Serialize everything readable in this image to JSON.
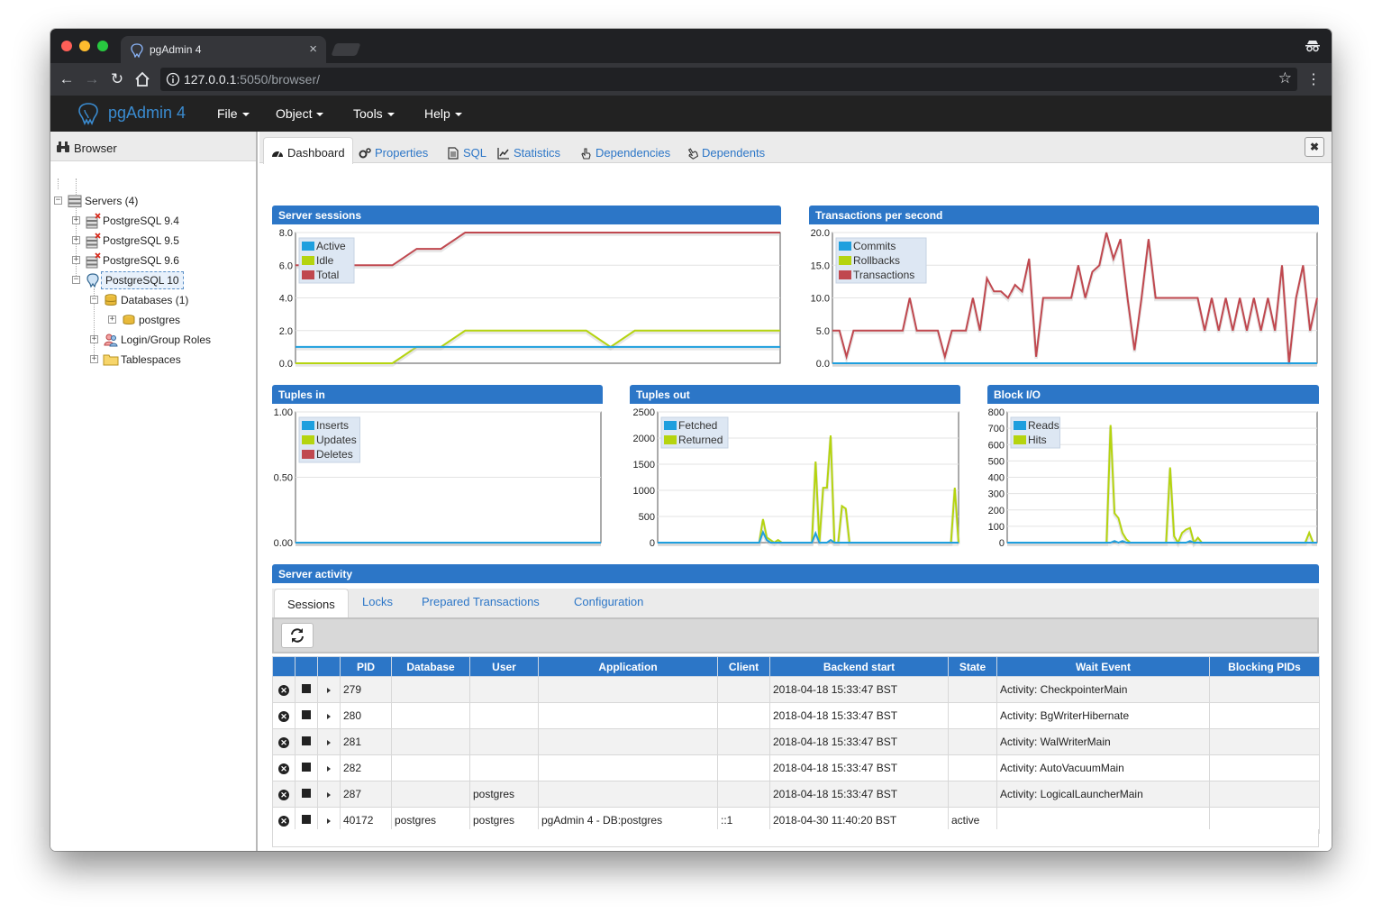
{
  "chrome": {
    "tab_title": "pgAdmin 4",
    "tab_close": "×",
    "url_host": "127.0.0.1",
    "url_rest": ":5050/browser/"
  },
  "app": {
    "brand": "pgAdmin 4",
    "menus": [
      "File",
      "Object",
      "Tools",
      "Help"
    ]
  },
  "browser_panel": {
    "title": "Browser",
    "tree": {
      "servers": "Servers (4)",
      "pg94": "PostgreSQL 9.4",
      "pg95": "PostgreSQL 9.5",
      "pg96": "PostgreSQL 9.6",
      "pg10": "PostgreSQL 10",
      "databases": "Databases (1)",
      "postgres": "postgres",
      "roles": "Login/Group Roles",
      "tablespaces": "Tablespaces"
    }
  },
  "main_tabs": [
    "Dashboard",
    "Properties",
    "SQL",
    "Statistics",
    "Dependencies",
    "Dependents"
  ],
  "close_label": "✖",
  "charts": {
    "server_sessions": {
      "title": "Server sessions",
      "legend": [
        "Active",
        "Idle",
        "Total"
      ],
      "yticks": [
        "0.0",
        "2.0",
        "4.0",
        "6.0",
        "8.0"
      ]
    },
    "tps": {
      "title": "Transactions per second",
      "legend": [
        "Commits",
        "Rollbacks",
        "Transactions"
      ],
      "yticks": [
        "0.0",
        "5.0",
        "10.0",
        "15.0",
        "20.0"
      ]
    },
    "tuples_in": {
      "title": "Tuples in",
      "legend": [
        "Inserts",
        "Updates",
        "Deletes"
      ],
      "yticks": [
        "0.00",
        "0.50",
        "1.00"
      ]
    },
    "tuples_out": {
      "title": "Tuples out",
      "legend": [
        "Fetched",
        "Returned"
      ],
      "yticks": [
        "0",
        "500",
        "1000",
        "1500",
        "2000",
        "2500"
      ]
    },
    "block_io": {
      "title": "Block I/O",
      "legend": [
        "Reads",
        "Hits"
      ],
      "yticks": [
        "0",
        "100",
        "200",
        "300",
        "400",
        "500",
        "600",
        "700",
        "800"
      ]
    }
  },
  "chart_data": [
    {
      "type": "line",
      "title": "Server sessions",
      "ylim": [
        0,
        8
      ],
      "x": [
        0,
        1,
        2,
        3,
        4,
        5,
        6,
        7,
        8,
        9,
        10,
        11,
        12,
        13,
        14,
        15,
        16,
        17,
        18,
        19,
        20
      ],
      "series": [
        {
          "name": "Active",
          "values": [
            1,
            1,
            1,
            1,
            1,
            1,
            1,
            1,
            1,
            1,
            1,
            1,
            1,
            1,
            1,
            1,
            1,
            1,
            1,
            1,
            1
          ]
        },
        {
          "name": "Idle",
          "values": [
            0,
            0,
            0,
            0,
            0,
            1,
            1,
            2,
            2,
            2,
            2,
            2,
            2,
            1,
            2,
            2,
            2,
            2,
            2,
            2,
            2
          ]
        },
        {
          "name": "Total",
          "values": [
            6,
            6,
            6,
            6,
            6,
            7,
            7,
            8,
            8,
            8,
            8,
            8,
            8,
            8,
            8,
            8,
            8,
            8,
            8,
            8,
            8
          ]
        }
      ],
      "colors": [
        "#1e9fde",
        "#b5d40f",
        "#c0484f"
      ]
    },
    {
      "type": "line",
      "title": "Transactions per second",
      "ylim": [
        0,
        20
      ],
      "series": [
        {
          "name": "Commits",
          "values": [
            0,
            0,
            0,
            0,
            0,
            0,
            0,
            0,
            0,
            0,
            0,
            0,
            0,
            0,
            0,
            0,
            0,
            0,
            0,
            0,
            0,
            0,
            0,
            0,
            0,
            0,
            0,
            0,
            0,
            0,
            0,
            0,
            0,
            0,
            0,
            0,
            0,
            0,
            0,
            0,
            0,
            0,
            0,
            0,
            0,
            0,
            0,
            0,
            0,
            0,
            0,
            0,
            0,
            0,
            0,
            0,
            0,
            0,
            0,
            0,
            0,
            0,
            0,
            0,
            0,
            0,
            0,
            0,
            0,
            0
          ]
        },
        {
          "name": "Rollbacks",
          "values": [
            0,
            0,
            0,
            0,
            0,
            0,
            0,
            0,
            0,
            0,
            0,
            0,
            0,
            0,
            0,
            0,
            0,
            0,
            0,
            0,
            0,
            0,
            0,
            0,
            0,
            0,
            0,
            0,
            0,
            0,
            0,
            0,
            0,
            0,
            0,
            0,
            0,
            0,
            0,
            0,
            0,
            0,
            0,
            0,
            0,
            0,
            0,
            0,
            0,
            0,
            0,
            0,
            0,
            0,
            0,
            0,
            0,
            0,
            0,
            0,
            0,
            0,
            0,
            0,
            0,
            0,
            0,
            0,
            0,
            0
          ]
        },
        {
          "name": "Transactions",
          "values": [
            5,
            5,
            1,
            5,
            5,
            5,
            5,
            5,
            5,
            5,
            5,
            10,
            5,
            5,
            5,
            5,
            1,
            5,
            5,
            5,
            10,
            5,
            13,
            11,
            11,
            10,
            12,
            11,
            16,
            1,
            10,
            10,
            10,
            10,
            10,
            15,
            10,
            14,
            15,
            20,
            16,
            19,
            10,
            2,
            10,
            19,
            10,
            10,
            10,
            10,
            10,
            10,
            10,
            5,
            10,
            5,
            10,
            5,
            10,
            5,
            10,
            5,
            10,
            5,
            15,
            0,
            10,
            15,
            5,
            10
          ]
        }
      ],
      "colors": [
        "#1e9fde",
        "#b5d40f",
        "#c0484f"
      ]
    },
    {
      "type": "line",
      "title": "Tuples in",
      "ylim": [
        0,
        1
      ],
      "series": [
        {
          "name": "Inserts",
          "values": [
            0,
            0,
            0,
            0,
            0,
            0,
            0,
            0,
            0,
            0
          ]
        },
        {
          "name": "Updates",
          "values": [
            0,
            0,
            0,
            0,
            0,
            0,
            0,
            0,
            0,
            0
          ]
        },
        {
          "name": "Deletes",
          "values": [
            0,
            0,
            0,
            0,
            0,
            0,
            0,
            0,
            0,
            0
          ]
        }
      ],
      "colors": [
        "#1e9fde",
        "#b5d40f",
        "#c0484f"
      ]
    },
    {
      "type": "line",
      "title": "Tuples out",
      "ylim": [
        0,
        2500
      ],
      "series": [
        {
          "name": "Fetched",
          "values": [
            0,
            0,
            0,
            0,
            0,
            0,
            0,
            0,
            0,
            0,
            0,
            0,
            0,
            0,
            0,
            0,
            0,
            0,
            0,
            0,
            0,
            0,
            0,
            0,
            0,
            0,
            0,
            0,
            200,
            50,
            0,
            0,
            0,
            0,
            0,
            0,
            0,
            0,
            0,
            0,
            0,
            0,
            180,
            0,
            0,
            0,
            50,
            0,
            0,
            0,
            0,
            0,
            0,
            0,
            0,
            0,
            0,
            0,
            0,
            0,
            0,
            0,
            0,
            0,
            0,
            0,
            0,
            0,
            0,
            0,
            0,
            0,
            0,
            0,
            0,
            0,
            0,
            0,
            0,
            0,
            0
          ]
        },
        {
          "name": "Returned",
          "values": [
            0,
            0,
            0,
            0,
            0,
            0,
            0,
            0,
            0,
            0,
            0,
            0,
            0,
            0,
            0,
            0,
            0,
            0,
            0,
            0,
            0,
            0,
            0,
            0,
            0,
            0,
            0,
            0,
            450,
            100,
            50,
            0,
            50,
            0,
            0,
            0,
            0,
            0,
            0,
            0,
            0,
            0,
            1550,
            0,
            1050,
            1050,
            2050,
            0,
            0,
            700,
            650,
            0,
            0,
            0,
            0,
            0,
            0,
            0,
            0,
            0,
            0,
            0,
            0,
            0,
            0,
            0,
            0,
            0,
            0,
            0,
            0,
            0,
            0,
            0,
            0,
            0,
            0,
            0,
            0,
            1050,
            0
          ]
        }
      ],
      "colors": [
        "#1e9fde",
        "#b5d40f"
      ]
    },
    {
      "type": "line",
      "title": "Block I/O",
      "ylim": [
        0,
        800
      ],
      "series": [
        {
          "name": "Reads",
          "values": [
            0,
            0,
            0,
            0,
            0,
            0,
            0,
            0,
            0,
            0,
            0,
            0,
            0,
            0,
            0,
            0,
            0,
            0,
            0,
            0,
            0,
            0,
            0,
            0,
            0,
            0,
            0,
            10,
            0,
            10,
            0,
            0,
            0,
            0,
            0,
            0,
            0,
            0,
            0,
            0,
            0,
            0,
            0,
            0,
            0,
            0,
            10,
            0,
            0,
            0,
            0,
            0,
            0,
            0,
            0,
            0,
            0,
            0,
            0,
            0,
            0,
            0,
            0,
            0,
            0,
            0,
            0,
            0,
            0,
            0,
            0,
            0,
            0,
            0,
            0,
            0,
            0,
            0,
            0
          ]
        },
        {
          "name": "Hits",
          "values": [
            0,
            0,
            0,
            0,
            0,
            0,
            0,
            0,
            0,
            0,
            0,
            0,
            0,
            0,
            0,
            0,
            0,
            0,
            0,
            0,
            0,
            0,
            0,
            0,
            0,
            0,
            720,
            180,
            150,
            60,
            20,
            0,
            0,
            0,
            0,
            0,
            0,
            0,
            0,
            0,
            0,
            460,
            40,
            0,
            60,
            80,
            90,
            0,
            30,
            0,
            0,
            0,
            0,
            0,
            0,
            0,
            0,
            0,
            0,
            0,
            0,
            0,
            0,
            0,
            0,
            0,
            0,
            0,
            0,
            0,
            0,
            0,
            0,
            0,
            0,
            0,
            60,
            0,
            0
          ]
        }
      ],
      "colors": [
        "#1e9fde",
        "#b5d40f"
      ]
    }
  ],
  "activity": {
    "title": "Server activity",
    "tabs": [
      "Sessions",
      "Locks",
      "Prepared Transactions",
      "Configuration"
    ],
    "columns": [
      "PID",
      "Database",
      "User",
      "Application",
      "Client",
      "Backend start",
      "State",
      "Wait Event",
      "Blocking PIDs"
    ],
    "rows": [
      {
        "pid": "279",
        "database": "",
        "user": "",
        "application": "",
        "client": "",
        "backend_start": "2018-04-18 15:33:47 BST",
        "state": "",
        "wait_event": "Activity: CheckpointerMain",
        "blocking": ""
      },
      {
        "pid": "280",
        "database": "",
        "user": "",
        "application": "",
        "client": "",
        "backend_start": "2018-04-18 15:33:47 BST",
        "state": "",
        "wait_event": "Activity: BgWriterHibernate",
        "blocking": ""
      },
      {
        "pid": "281",
        "database": "",
        "user": "",
        "application": "",
        "client": "",
        "backend_start": "2018-04-18 15:33:47 BST",
        "state": "",
        "wait_event": "Activity: WalWriterMain",
        "blocking": ""
      },
      {
        "pid": "282",
        "database": "",
        "user": "",
        "application": "",
        "client": "",
        "backend_start": "2018-04-18 15:33:47 BST",
        "state": "",
        "wait_event": "Activity: AutoVacuumMain",
        "blocking": ""
      },
      {
        "pid": "287",
        "database": "",
        "user": "postgres",
        "application": "",
        "client": "",
        "backend_start": "2018-04-18 15:33:47 BST",
        "state": "",
        "wait_event": "Activity: LogicalLauncherMain",
        "blocking": ""
      },
      {
        "pid": "40172",
        "database": "postgres",
        "user": "postgres",
        "application": "pgAdmin 4 - DB:postgres",
        "client": "::1",
        "backend_start": "2018-04-30 11:40:20 BST",
        "state": "active",
        "wait_event": "",
        "blocking": ""
      }
    ]
  }
}
